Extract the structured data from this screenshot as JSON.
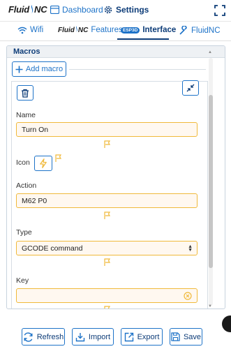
{
  "header": {
    "logo_text_1": "Fluid",
    "logo_text_2": "NC",
    "dashboard_label": "Dashboard",
    "settings_label": "Settings"
  },
  "tabs": {
    "wifi": "Wifi",
    "features_logo_1": "Fluid",
    "features_logo_2": "NC",
    "features": "Features",
    "interface_badge": "ESP3D",
    "interface": "Interface",
    "fluidnc": "FluidNC"
  },
  "macros": {
    "section_title": "Macros",
    "add_label": "Add macro",
    "name_label": "Name",
    "name_value": "Turn On",
    "icon_label": "Icon",
    "action_label": "Action",
    "action_value": "M62 P0",
    "type_label": "Type",
    "type_value": "GCODE command",
    "key_label": "Key",
    "key_value": ""
  },
  "footer": {
    "refresh": "Refresh",
    "import": "Import",
    "export": "Export",
    "save": "Save"
  },
  "colors": {
    "primary": "#1e73c8",
    "primary_dark": "#0d3c78",
    "warning": "#f0b93a",
    "warning_bg": "#fff8f0"
  },
  "icons": {
    "dashboard": "dashboard-icon",
    "settings": "gear-icon",
    "fullscreen": "fullscreen-icon",
    "wifi": "wifi-icon",
    "fluidnc": "wrench-icon",
    "add": "plus-icon",
    "delete": "trash-icon",
    "collapse": "collapse-icon",
    "macro_icon": "lightning-icon",
    "flag": "flag-icon",
    "clear": "clear-icon",
    "refresh": "refresh-icon",
    "import": "import-icon",
    "export": "export-icon",
    "save": "save-icon"
  }
}
